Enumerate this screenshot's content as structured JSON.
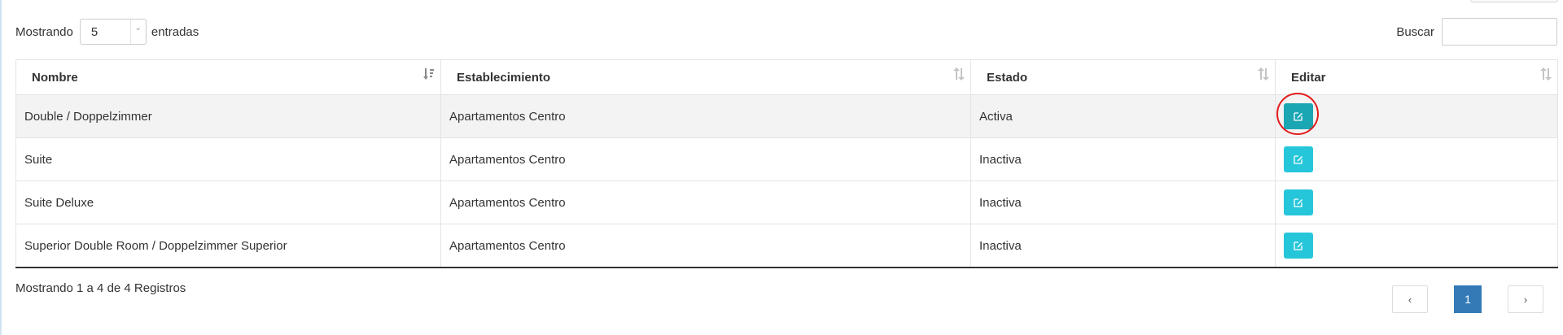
{
  "length_control": {
    "prefix": "Mostrando",
    "value": "5",
    "suffix": "entradas"
  },
  "search": {
    "label": "Buscar",
    "value": ""
  },
  "table": {
    "headers": [
      "Nombre",
      "Establecimiento",
      "Estado",
      "Editar"
    ],
    "rows": [
      {
        "nombre": "Double / Doppelzimmer",
        "establecimiento": "Apartamentos Centro",
        "estado": "Activa"
      },
      {
        "nombre": "Suite",
        "establecimiento": "Apartamentos Centro",
        "estado": "Inactiva"
      },
      {
        "nombre": "Suite Deluxe",
        "establecimiento": "Apartamentos Centro",
        "estado": "Inactiva"
      },
      {
        "nombre": "Superior Double Room / Doppelzimmer Superior",
        "establecimiento": "Apartamentos Centro",
        "estado": "Inactiva"
      }
    ]
  },
  "footer": {
    "info": "Mostrando 1 a 4 de 4 Registros"
  },
  "pagination": {
    "prev": "‹",
    "current": "1",
    "next": "›"
  },
  "icons": {
    "edit": "edit-square-icon",
    "sort": "sort-arrows-icon"
  },
  "colors": {
    "edit_button": "#26c6da",
    "edit_button_active": "#1ba6b4",
    "page_active": "#337ab7",
    "highlight_ring": "#e21b1b"
  }
}
